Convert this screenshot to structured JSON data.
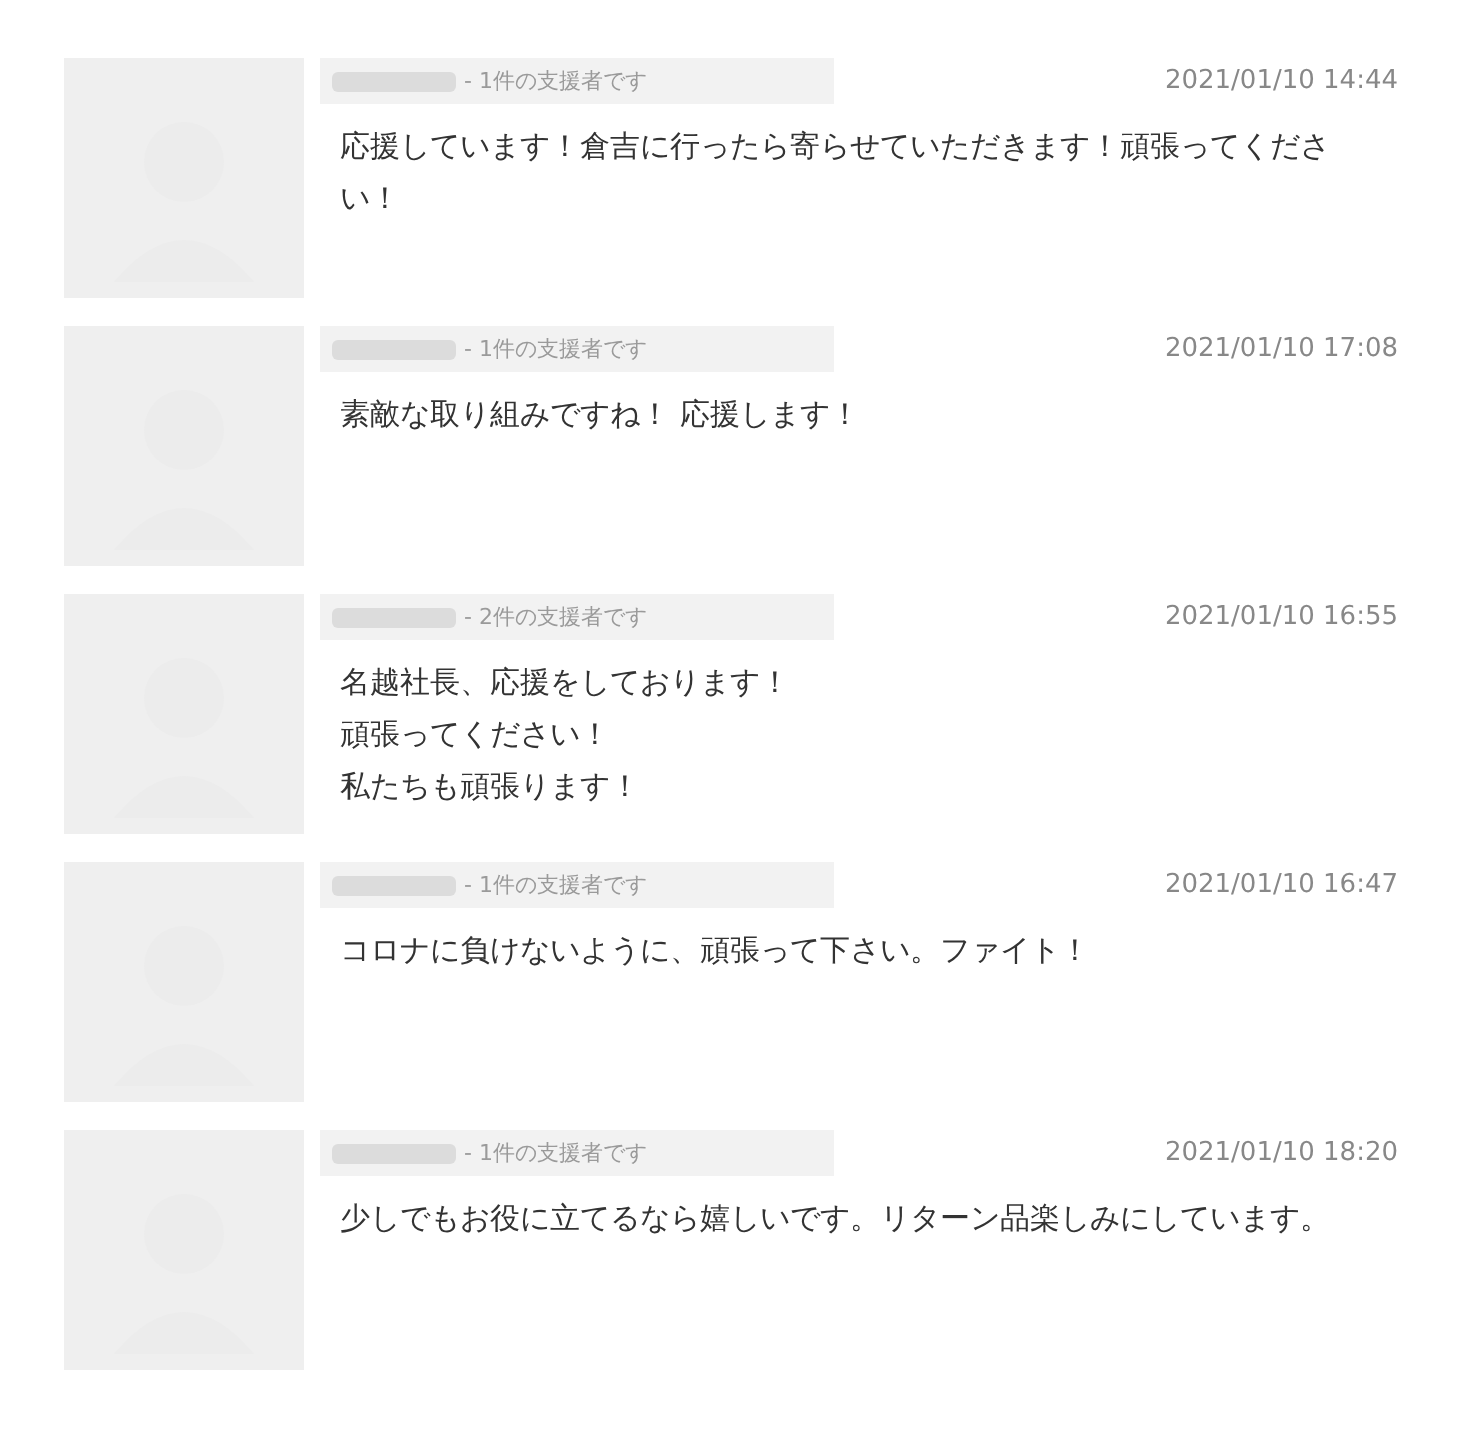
{
  "comments": [
    {
      "supporter": "- 1件の支援者です",
      "date": "2021/01/10 14:44",
      "lines": [
        "応援しています！倉吉に行ったら寄らせていただきます！頑張ってください！"
      ]
    },
    {
      "supporter": "- 1件の支援者です",
      "date": "2021/01/10 17:08",
      "lines": [
        "素敵な取り組みですね！ 応援します！"
      ]
    },
    {
      "supporter": "- 2件の支援者です",
      "date": "2021/01/10 16:55",
      "lines": [
        "名越社長、応援をしております！",
        "頑張ってください！",
        "私たちも頑張ります！"
      ]
    },
    {
      "supporter": "- 1件の支援者です",
      "date": "2021/01/10 16:47",
      "lines": [
        "コロナに負けないように、頑張って下さい。ファイト！"
      ]
    },
    {
      "supporter": "- 1件の支援者です",
      "date": "2021/01/10 18:20",
      "lines": [
        "少しでもお役に立てるなら嬉しいです。リターン品楽しみにしています。"
      ]
    }
  ]
}
